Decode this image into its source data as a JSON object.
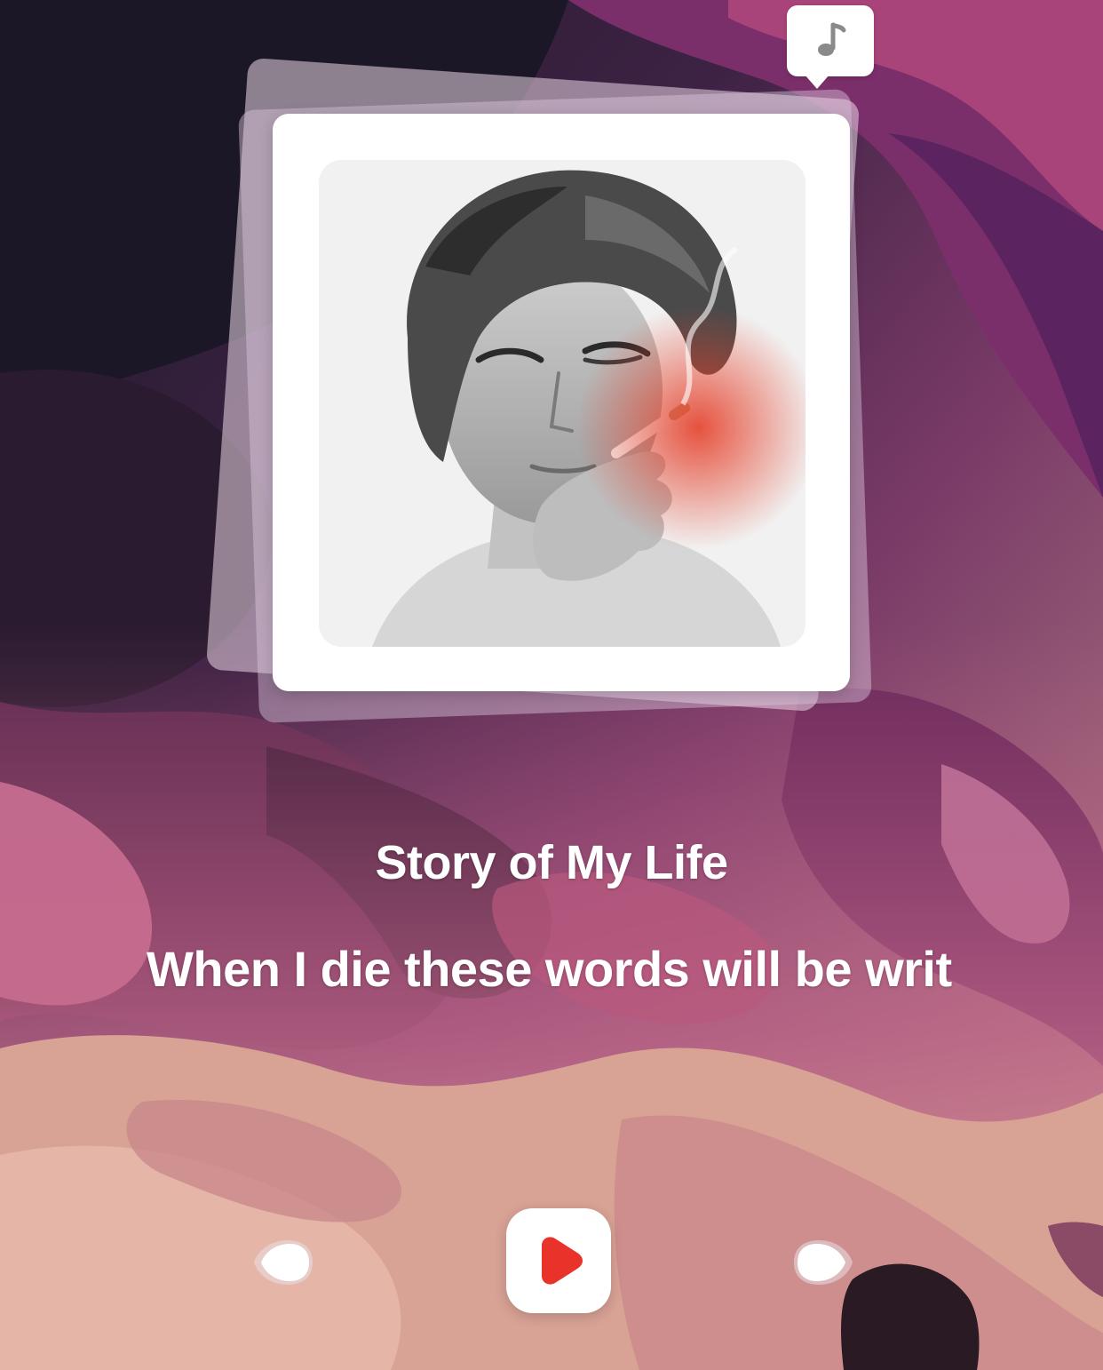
{
  "song": {
    "title": "Story of My Life",
    "lyric": "When I die these words will be writ"
  },
  "icons": {
    "note": "music-note-icon",
    "prev": "previous-track-icon",
    "play": "play-icon",
    "next": "next-track-icon"
  },
  "colors": {
    "accent": "#e8322a",
    "card": "#ffffff",
    "text": "#ffffff"
  }
}
